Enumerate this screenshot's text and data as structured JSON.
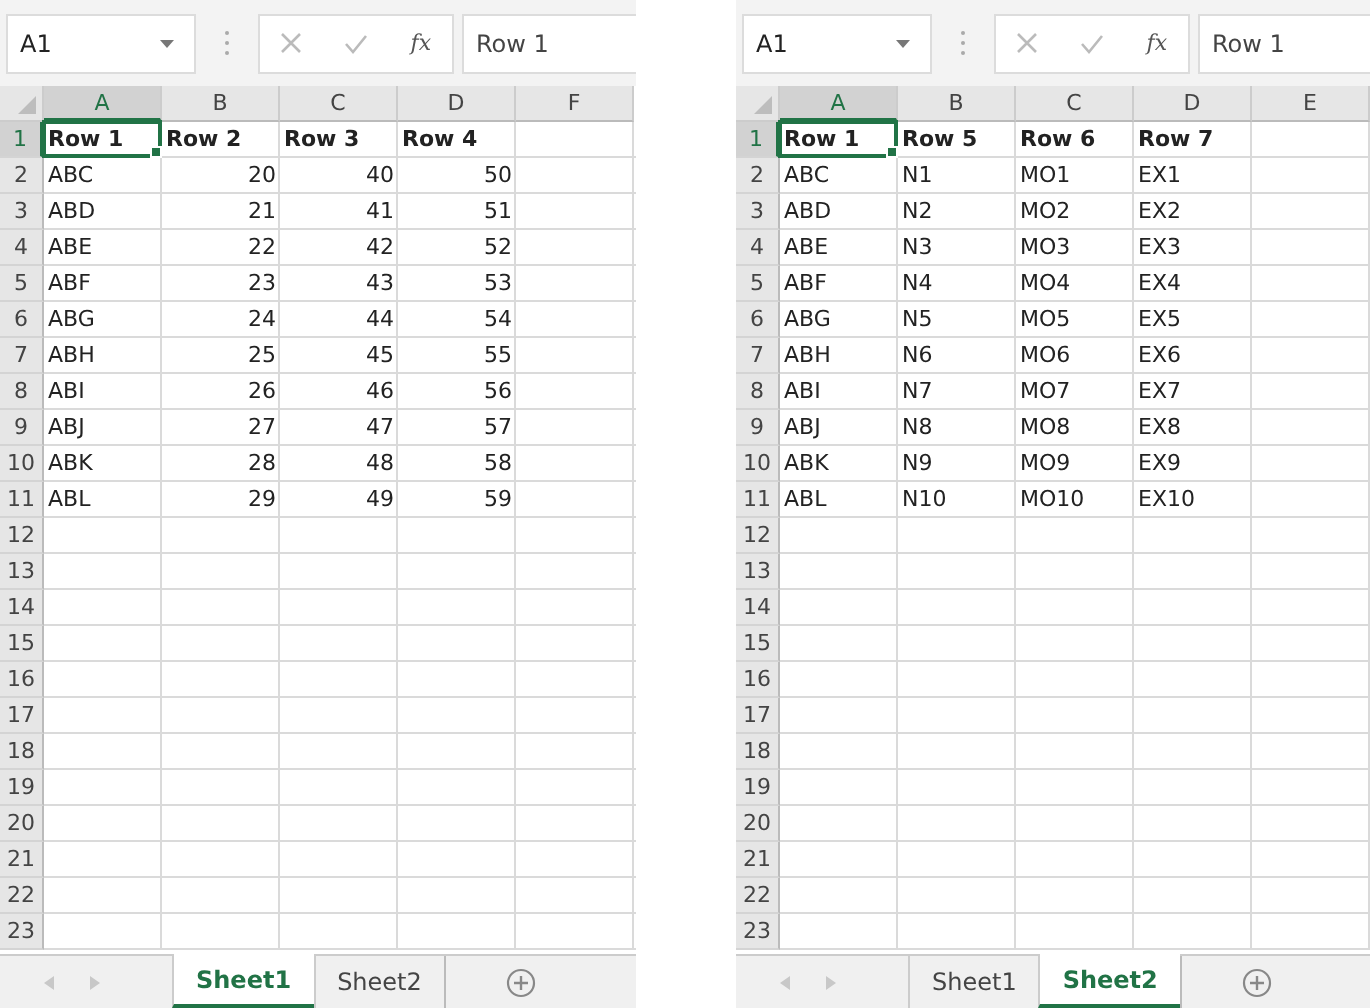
{
  "windows": [
    {
      "name_box": "A1",
      "function_label": "fx",
      "formula": "Row 1",
      "columns": [
        {
          "label": "A",
          "selected": true
        },
        {
          "label": "B",
          "selected": false
        },
        {
          "label": "C",
          "selected": false
        },
        {
          "label": "D",
          "selected": false
        },
        {
          "label": "F",
          "selected": false
        }
      ],
      "rows": [
        {
          "number": "1",
          "selected": true,
          "bold": true,
          "cells": [
            "Row 1",
            "Row 2",
            "Row 3",
            "Row 4"
          ]
        },
        {
          "number": "2",
          "selected": false,
          "bold": false,
          "cells": [
            "ABC",
            "20",
            "40",
            "50"
          ]
        },
        {
          "number": "3",
          "selected": false,
          "bold": false,
          "cells": [
            "ABD",
            "21",
            "41",
            "51"
          ]
        },
        {
          "number": "4",
          "selected": false,
          "bold": false,
          "cells": [
            "ABE",
            "22",
            "42",
            "52"
          ]
        },
        {
          "number": "5",
          "selected": false,
          "bold": false,
          "cells": [
            "ABF",
            "23",
            "43",
            "53"
          ]
        },
        {
          "number": "6",
          "selected": false,
          "bold": false,
          "cells": [
            "ABG",
            "24",
            "44",
            "54"
          ]
        },
        {
          "number": "7",
          "selected": false,
          "bold": false,
          "cells": [
            "ABH",
            "25",
            "45",
            "55"
          ]
        },
        {
          "number": "8",
          "selected": false,
          "bold": false,
          "cells": [
            "ABI",
            "26",
            "46",
            "56"
          ]
        },
        {
          "number": "9",
          "selected": false,
          "bold": false,
          "cells": [
            "ABJ",
            "27",
            "47",
            "57"
          ]
        },
        {
          "number": "10",
          "selected": false,
          "bold": false,
          "cells": [
            "ABK",
            "28",
            "48",
            "58"
          ]
        },
        {
          "number": "11",
          "selected": false,
          "bold": false,
          "cells": [
            "ABL",
            "29",
            "49",
            "59"
          ]
        },
        {
          "number": "12",
          "selected": false
        },
        {
          "number": "13",
          "selected": false
        },
        {
          "number": "14",
          "selected": false
        },
        {
          "number": "15",
          "selected": false
        },
        {
          "number": "16",
          "selected": false
        },
        {
          "number": "17",
          "selected": false
        },
        {
          "number": "18",
          "selected": false
        },
        {
          "number": "19",
          "selected": false
        },
        {
          "number": "20",
          "selected": false
        },
        {
          "number": "21",
          "selected": false
        },
        {
          "number": "22",
          "selected": false
        },
        {
          "number": "23",
          "selected": false
        }
      ],
      "tabs": [
        {
          "label": "Sheet1",
          "selected": true
        },
        {
          "label": "Sheet2",
          "selected": false
        }
      ]
    },
    {
      "name_box": "A1",
      "function_label": "fx",
      "formula": "Row 1",
      "columns": [
        {
          "label": "A",
          "selected": true
        },
        {
          "label": "B",
          "selected": false
        },
        {
          "label": "C",
          "selected": false
        },
        {
          "label": "D",
          "selected": false
        },
        {
          "label": "E",
          "selected": false
        }
      ],
      "rows": [
        {
          "number": "1",
          "selected": true,
          "bold": true,
          "cells": [
            "Row 1",
            "Row 5",
            "Row 6",
            "Row 7"
          ]
        },
        {
          "number": "2",
          "selected": false,
          "bold": false,
          "cells": [
            "ABC",
            "N1",
            "MO1",
            "EX1"
          ]
        },
        {
          "number": "3",
          "selected": false,
          "bold": false,
          "cells": [
            "ABD",
            "N2",
            "MO2",
            "EX2"
          ]
        },
        {
          "number": "4",
          "selected": false,
          "bold": false,
          "cells": [
            "ABE",
            "N3",
            "MO3",
            "EX3"
          ]
        },
        {
          "number": "5",
          "selected": false,
          "bold": false,
          "cells": [
            "ABF",
            "N4",
            "MO4",
            "EX4"
          ]
        },
        {
          "number": "6",
          "selected": false,
          "bold": false,
          "cells": [
            "ABG",
            "N5",
            "MO5",
            "EX5"
          ]
        },
        {
          "number": "7",
          "selected": false,
          "bold": false,
          "cells": [
            "ABH",
            "N6",
            "MO6",
            "EX6"
          ]
        },
        {
          "number": "8",
          "selected": false,
          "bold": false,
          "cells": [
            "ABI",
            "N7",
            "MO7",
            "EX7"
          ]
        },
        {
          "number": "9",
          "selected": false,
          "bold": false,
          "cells": [
            "ABJ",
            "N8",
            "MO8",
            "EX8"
          ]
        },
        {
          "number": "10",
          "selected": false,
          "bold": false,
          "cells": [
            "ABK",
            "N9",
            "MO9",
            "EX9"
          ]
        },
        {
          "number": "11",
          "selected": false,
          "bold": false,
          "cells": [
            "ABL",
            "N10",
            "MO10",
            "EX10"
          ]
        },
        {
          "number": "12",
          "selected": false
        },
        {
          "number": "13",
          "selected": false
        },
        {
          "number": "14",
          "selected": false
        },
        {
          "number": "15",
          "selected": false
        },
        {
          "number": "16",
          "selected": false
        },
        {
          "number": "17",
          "selected": false
        },
        {
          "number": "18",
          "selected": false
        },
        {
          "number": "19",
          "selected": false
        },
        {
          "number": "20",
          "selected": false
        },
        {
          "number": "21",
          "selected": false
        },
        {
          "number": "22",
          "selected": false
        },
        {
          "number": "23",
          "selected": false
        }
      ],
      "tabs": [
        {
          "label": "Sheet1",
          "selected": false
        },
        {
          "label": "Sheet2",
          "selected": true
        }
      ]
    }
  ]
}
